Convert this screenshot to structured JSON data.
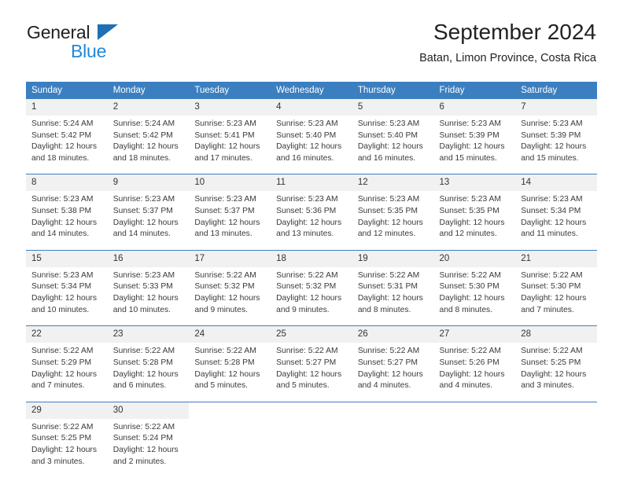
{
  "brand": {
    "name_top": "General",
    "name_bottom": "Blue",
    "triangle_color": "#1f6fb4",
    "blue_text_color": "#2288d6"
  },
  "header": {
    "title": "September 2024",
    "subtitle": "Batan, Limon Province, Costa Rica"
  },
  "theme": {
    "header_blue": "#3c7fc1",
    "daynum_bg": "#f1f1f1",
    "text": "#333333"
  },
  "weekday_headers": [
    "Sunday",
    "Monday",
    "Tuesday",
    "Wednesday",
    "Thursday",
    "Friday",
    "Saturday"
  ],
  "labels": {
    "sunrise_prefix": "Sunrise:",
    "sunset_prefix": "Sunset:",
    "daylight_prefix": "Daylight:"
  },
  "weeks": [
    [
      {
        "day": "1",
        "sunrise": "Sunrise: 5:24 AM",
        "sunset": "Sunset: 5:42 PM",
        "daylight_l1": "Daylight: 12 hours",
        "daylight_l2": "and 18 minutes."
      },
      {
        "day": "2",
        "sunrise": "Sunrise: 5:24 AM",
        "sunset": "Sunset: 5:42 PM",
        "daylight_l1": "Daylight: 12 hours",
        "daylight_l2": "and 18 minutes."
      },
      {
        "day": "3",
        "sunrise": "Sunrise: 5:23 AM",
        "sunset": "Sunset: 5:41 PM",
        "daylight_l1": "Daylight: 12 hours",
        "daylight_l2": "and 17 minutes."
      },
      {
        "day": "4",
        "sunrise": "Sunrise: 5:23 AM",
        "sunset": "Sunset: 5:40 PM",
        "daylight_l1": "Daylight: 12 hours",
        "daylight_l2": "and 16 minutes."
      },
      {
        "day": "5",
        "sunrise": "Sunrise: 5:23 AM",
        "sunset": "Sunset: 5:40 PM",
        "daylight_l1": "Daylight: 12 hours",
        "daylight_l2": "and 16 minutes."
      },
      {
        "day": "6",
        "sunrise": "Sunrise: 5:23 AM",
        "sunset": "Sunset: 5:39 PM",
        "daylight_l1": "Daylight: 12 hours",
        "daylight_l2": "and 15 minutes."
      },
      {
        "day": "7",
        "sunrise": "Sunrise: 5:23 AM",
        "sunset": "Sunset: 5:39 PM",
        "daylight_l1": "Daylight: 12 hours",
        "daylight_l2": "and 15 minutes."
      }
    ],
    [
      {
        "day": "8",
        "sunrise": "Sunrise: 5:23 AM",
        "sunset": "Sunset: 5:38 PM",
        "daylight_l1": "Daylight: 12 hours",
        "daylight_l2": "and 14 minutes."
      },
      {
        "day": "9",
        "sunrise": "Sunrise: 5:23 AM",
        "sunset": "Sunset: 5:37 PM",
        "daylight_l1": "Daylight: 12 hours",
        "daylight_l2": "and 14 minutes."
      },
      {
        "day": "10",
        "sunrise": "Sunrise: 5:23 AM",
        "sunset": "Sunset: 5:37 PM",
        "daylight_l1": "Daylight: 12 hours",
        "daylight_l2": "and 13 minutes."
      },
      {
        "day": "11",
        "sunrise": "Sunrise: 5:23 AM",
        "sunset": "Sunset: 5:36 PM",
        "daylight_l1": "Daylight: 12 hours",
        "daylight_l2": "and 13 minutes."
      },
      {
        "day": "12",
        "sunrise": "Sunrise: 5:23 AM",
        "sunset": "Sunset: 5:35 PM",
        "daylight_l1": "Daylight: 12 hours",
        "daylight_l2": "and 12 minutes."
      },
      {
        "day": "13",
        "sunrise": "Sunrise: 5:23 AM",
        "sunset": "Sunset: 5:35 PM",
        "daylight_l1": "Daylight: 12 hours",
        "daylight_l2": "and 12 minutes."
      },
      {
        "day": "14",
        "sunrise": "Sunrise: 5:23 AM",
        "sunset": "Sunset: 5:34 PM",
        "daylight_l1": "Daylight: 12 hours",
        "daylight_l2": "and 11 minutes."
      }
    ],
    [
      {
        "day": "15",
        "sunrise": "Sunrise: 5:23 AM",
        "sunset": "Sunset: 5:34 PM",
        "daylight_l1": "Daylight: 12 hours",
        "daylight_l2": "and 10 minutes."
      },
      {
        "day": "16",
        "sunrise": "Sunrise: 5:23 AM",
        "sunset": "Sunset: 5:33 PM",
        "daylight_l1": "Daylight: 12 hours",
        "daylight_l2": "and 10 minutes."
      },
      {
        "day": "17",
        "sunrise": "Sunrise: 5:22 AM",
        "sunset": "Sunset: 5:32 PM",
        "daylight_l1": "Daylight: 12 hours",
        "daylight_l2": "and 9 minutes."
      },
      {
        "day": "18",
        "sunrise": "Sunrise: 5:22 AM",
        "sunset": "Sunset: 5:32 PM",
        "daylight_l1": "Daylight: 12 hours",
        "daylight_l2": "and 9 minutes."
      },
      {
        "day": "19",
        "sunrise": "Sunrise: 5:22 AM",
        "sunset": "Sunset: 5:31 PM",
        "daylight_l1": "Daylight: 12 hours",
        "daylight_l2": "and 8 minutes."
      },
      {
        "day": "20",
        "sunrise": "Sunrise: 5:22 AM",
        "sunset": "Sunset: 5:30 PM",
        "daylight_l1": "Daylight: 12 hours",
        "daylight_l2": "and 8 minutes."
      },
      {
        "day": "21",
        "sunrise": "Sunrise: 5:22 AM",
        "sunset": "Sunset: 5:30 PM",
        "daylight_l1": "Daylight: 12 hours",
        "daylight_l2": "and 7 minutes."
      }
    ],
    [
      {
        "day": "22",
        "sunrise": "Sunrise: 5:22 AM",
        "sunset": "Sunset: 5:29 PM",
        "daylight_l1": "Daylight: 12 hours",
        "daylight_l2": "and 7 minutes."
      },
      {
        "day": "23",
        "sunrise": "Sunrise: 5:22 AM",
        "sunset": "Sunset: 5:28 PM",
        "daylight_l1": "Daylight: 12 hours",
        "daylight_l2": "and 6 minutes."
      },
      {
        "day": "24",
        "sunrise": "Sunrise: 5:22 AM",
        "sunset": "Sunset: 5:28 PM",
        "daylight_l1": "Daylight: 12 hours",
        "daylight_l2": "and 5 minutes."
      },
      {
        "day": "25",
        "sunrise": "Sunrise: 5:22 AM",
        "sunset": "Sunset: 5:27 PM",
        "daylight_l1": "Daylight: 12 hours",
        "daylight_l2": "and 5 minutes."
      },
      {
        "day": "26",
        "sunrise": "Sunrise: 5:22 AM",
        "sunset": "Sunset: 5:27 PM",
        "daylight_l1": "Daylight: 12 hours",
        "daylight_l2": "and 4 minutes."
      },
      {
        "day": "27",
        "sunrise": "Sunrise: 5:22 AM",
        "sunset": "Sunset: 5:26 PM",
        "daylight_l1": "Daylight: 12 hours",
        "daylight_l2": "and 4 minutes."
      },
      {
        "day": "28",
        "sunrise": "Sunrise: 5:22 AM",
        "sunset": "Sunset: 5:25 PM",
        "daylight_l1": "Daylight: 12 hours",
        "daylight_l2": "and 3 minutes."
      }
    ],
    [
      {
        "day": "29",
        "sunrise": "Sunrise: 5:22 AM",
        "sunset": "Sunset: 5:25 PM",
        "daylight_l1": "Daylight: 12 hours",
        "daylight_l2": "and 3 minutes."
      },
      {
        "day": "30",
        "sunrise": "Sunrise: 5:22 AM",
        "sunset": "Sunset: 5:24 PM",
        "daylight_l1": "Daylight: 12 hours",
        "daylight_l2": "and 2 minutes."
      },
      {
        "day": "",
        "sunrise": "",
        "sunset": "",
        "daylight_l1": "",
        "daylight_l2": ""
      },
      {
        "day": "",
        "sunrise": "",
        "sunset": "",
        "daylight_l1": "",
        "daylight_l2": ""
      },
      {
        "day": "",
        "sunrise": "",
        "sunset": "",
        "daylight_l1": "",
        "daylight_l2": ""
      },
      {
        "day": "",
        "sunrise": "",
        "sunset": "",
        "daylight_l1": "",
        "daylight_l2": ""
      },
      {
        "day": "",
        "sunrise": "",
        "sunset": "",
        "daylight_l1": "",
        "daylight_l2": ""
      }
    ]
  ]
}
